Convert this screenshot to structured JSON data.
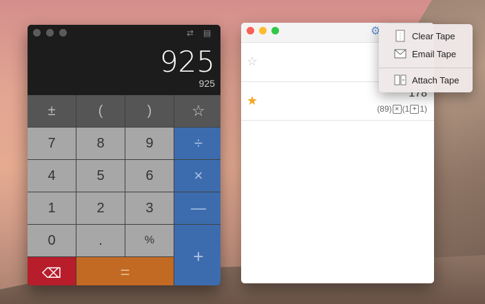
{
  "calculator": {
    "display_main": "925",
    "display_sub": "925",
    "titlebar_icons": {
      "swap": "⇄",
      "tape": "▤"
    },
    "keys": [
      {
        "id": "plus-minus",
        "label": "±",
        "style": "top"
      },
      {
        "id": "open-paren",
        "label": "(",
        "style": "top"
      },
      {
        "id": "close-paren",
        "label": ")",
        "style": "top"
      },
      {
        "id": "star",
        "label": "☆",
        "style": "top"
      },
      {
        "id": "7",
        "label": "7",
        "style": "num"
      },
      {
        "id": "8",
        "label": "8",
        "style": "num"
      },
      {
        "id": "9",
        "label": "9",
        "style": "num"
      },
      {
        "id": "divide",
        "label": "÷",
        "style": "op"
      },
      {
        "id": "4",
        "label": "4",
        "style": "num"
      },
      {
        "id": "5",
        "label": "5",
        "style": "num"
      },
      {
        "id": "6",
        "label": "6",
        "style": "num"
      },
      {
        "id": "multiply",
        "label": "×",
        "style": "op"
      },
      {
        "id": "1",
        "label": "1",
        "style": "num"
      },
      {
        "id": "2",
        "label": "2",
        "style": "num"
      },
      {
        "id": "3",
        "label": "3",
        "style": "num"
      },
      {
        "id": "minus",
        "label": "—",
        "style": "op"
      },
      {
        "id": "0",
        "label": "0",
        "style": "num"
      },
      {
        "id": "decimal",
        "label": ".",
        "style": "num"
      },
      {
        "id": "percent",
        "label": "%",
        "style": "num"
      },
      {
        "id": "plus",
        "label": "+",
        "style": "op"
      },
      {
        "id": "delete",
        "label": "⌫",
        "style": "del"
      },
      {
        "id": "equals",
        "label": "=",
        "style": "eq"
      }
    ]
  },
  "tape": {
    "gear_icon": "⚙",
    "traffic_colors": {
      "close": "#fc5f57",
      "min": "#fdbc2e",
      "max": "#33c748"
    },
    "rows": [
      {
        "starred": false,
        "star_icon": "☆"
      },
      {
        "starred": true,
        "star_icon": "★",
        "value": "178",
        "formula": {
          "open": "(89)",
          "op1": "×",
          "mid": "(1",
          "op2": "+",
          "close": "1)"
        }
      }
    ]
  },
  "menu": {
    "items": [
      {
        "label": "Clear Tape",
        "icon": "clear-tape-icon"
      },
      {
        "label": "Email Tape",
        "icon": "email-icon"
      },
      {
        "label": "Attach Tape",
        "icon": "attach-icon"
      }
    ]
  },
  "colors": {
    "accent_blue": "#3d6cae",
    "delete_red": "#b81d2b",
    "equals_orange": "#c26a24",
    "star_gold": "#f5a623"
  }
}
